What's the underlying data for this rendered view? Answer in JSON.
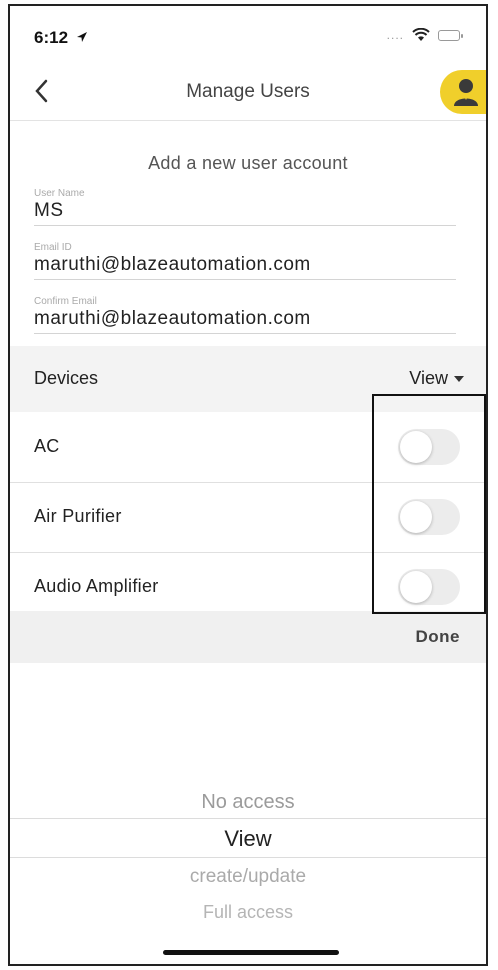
{
  "status_bar": {
    "time": "6:12",
    "signal_dots": "....",
    "icons": [
      "location-arrow-icon",
      "wifi-icon",
      "battery-icon"
    ]
  },
  "header": {
    "title": "Manage Users",
    "back_icon": "chevron-left-icon",
    "avatar_icon": "user-avatar-icon",
    "accent_color": "#f0cf2b"
  },
  "form": {
    "title": "Add a new user account",
    "user_name": {
      "label": "User Name",
      "value": "MS"
    },
    "email": {
      "label": "Email ID",
      "value": "maruthi@blazeautomation.com"
    },
    "confirm_email": {
      "label": "Confirm Email",
      "value": "maruthi@blazeautomation.com"
    }
  },
  "devices": {
    "label": "Devices",
    "view_label": "View",
    "items": [
      {
        "label": "AC",
        "enabled": false
      },
      {
        "label": "Air Purifier",
        "enabled": false
      },
      {
        "label": "Audio Amplifier",
        "enabled": false
      }
    ]
  },
  "done_label": "Done",
  "picker": {
    "options": [
      "No access",
      "View",
      "create/update",
      "Full access"
    ],
    "selected": "View"
  }
}
